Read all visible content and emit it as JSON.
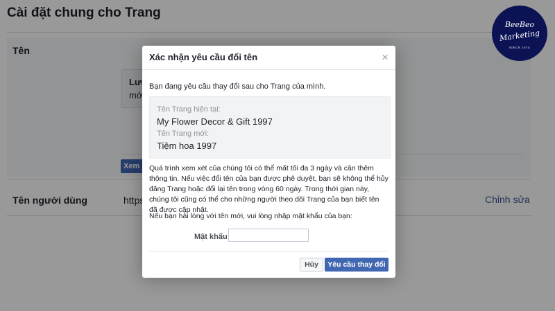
{
  "page": {
    "title": "Cài đặt chung cho Trang",
    "name_section_label": "Tên",
    "notice_title": "Lưu",
    "notice_sub": "mới",
    "view_button_label": "Xem",
    "username_label": "Tên người dùng",
    "username_url": "https:",
    "edit_link": "Chỉnh sửa"
  },
  "logo": {
    "line1": "BeeBeo",
    "line2": "Marketing",
    "line3": "SINCE 2014"
  },
  "dialog": {
    "title": "Xác nhận yêu cầu đổi tên",
    "close_glyph": "×",
    "intro": "Bạn đang yêu cầu thay đổi sau cho Trang của mình.",
    "current_name_label": "Tên Trang hiện tại:",
    "current_name": "My Flower Decor & Gift 1997",
    "new_name_label": "Tên Trang mới:",
    "new_name": "Tiệm hoa 1997",
    "paragraph": "Quá trình xem xét của chúng tôi có thể mất tối đa 3 ngày và cần thêm thông tin. Nếu việc đổi tên của bạn được phê duyệt, bạn sẽ không thể hủy đăng Trang hoặc đổi lại tên trong vòng 60 ngày. Trong thời gian này, chúng tôi cũng có thể cho những người theo dõi Trang của bạn biết tên đã được cập nhật.",
    "prompt": "Nếu bạn hài lòng với tên mới, vui lòng nhập mật khẩu của bạn:",
    "password_label": "Mật khẩu",
    "password_value": "",
    "cancel_label": "Hủy",
    "submit_label": "Yêu cầu thay đổi"
  },
  "colors": {
    "accent": "#4267b2",
    "link": "#385898",
    "logo_bg": "#0c1355"
  }
}
